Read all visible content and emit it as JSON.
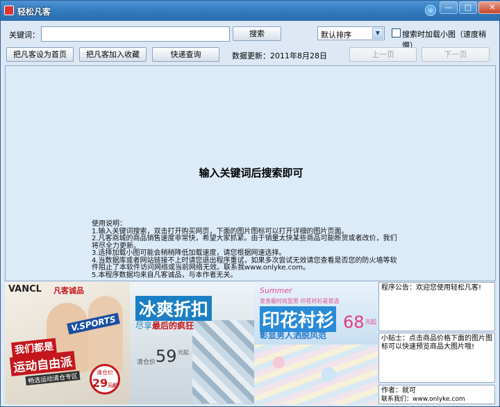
{
  "window": {
    "title": "轻松凡客",
    "controls": {
      "minimize": "—",
      "maximize": "□",
      "close": "✕"
    }
  },
  "search": {
    "label": "关键词：",
    "value": "",
    "placeholder": "",
    "button": "搜索",
    "sort_selected": "默认排序",
    "load_images_label": "搜索时加载小图（速度稍慢）",
    "load_images_checked": false
  },
  "toolbar": {
    "set_homepage": "把凡客设为首页",
    "add_favorite": "把凡客加入收藏",
    "quick_query": "快递查询",
    "data_update": "数据更新：2011年8月28日",
    "prev_page": "上一页",
    "next_page": "下一页"
  },
  "results": {
    "prompt": "输入关键词后搜索即可",
    "usage_title": "使用说明：",
    "usage_lines": [
      "1.输入关键词搜索，双击打开购买网页，下面的图片图标可以打开详细的图片页面。",
      "2.凡客商城的商品销售速度非常快，希望大家抓紧。由于销量太快某些商品可能断货或者改价，我们",
      "将尽全力更新。",
      "3.选择加载小图可能会稍稍降低加载速度，请您根据网速选择。",
      "4.当数据库或者网站链接不上时请您退出程序重试，如果多次尝试无效请您查看是否您的防火墙等软",
      "件阻止了本软件访问网络或当前网络无效。联系我www.onlyke.com。",
      "5.本程序数据均来自凡客诚品，与本作者无关。"
    ]
  },
  "ads": {
    "ad1": {
      "brand": "VANCL",
      "brand_cn": "凡客诚品",
      "sport_tag": "V.SPORTS",
      "line1": "我们都是",
      "line2": "运动自由派",
      "line3": "畅选运动清仓专区",
      "price_label": "清仓价",
      "price": "29",
      "price_unit": "元起"
    },
    "ad2": {
      "headline": "冰爽折扣",
      "sub_prefix": "尽享",
      "sub_highlight": "最后的疯狂",
      "price_label": "清仓价",
      "price": "59",
      "price_unit": "元起"
    },
    "ad3": {
      "season": "Summer",
      "tagline": "变身最时尚型男 印花衬衫是首选",
      "headline": "印花衬衫",
      "sub": "彰显男人洒脱风范",
      "price": "68",
      "price_unit": "元起"
    }
  },
  "sidebar": {
    "notice": "程序公告：欢迎您使用轻松凡客!",
    "tip": "小贴士：点击商品价格下面的图片图标可以快速预览商品大图片哦!",
    "author": "作者：就可",
    "contact": "联系我们：www.onlyke.com"
  },
  "colors": {
    "titlebar": "#2f79bd",
    "client_bg": "#dde8f4",
    "panel_bg": "#dcebf8",
    "vancl_red": "#c4161c",
    "ad_blue": "#1c7fc4"
  }
}
